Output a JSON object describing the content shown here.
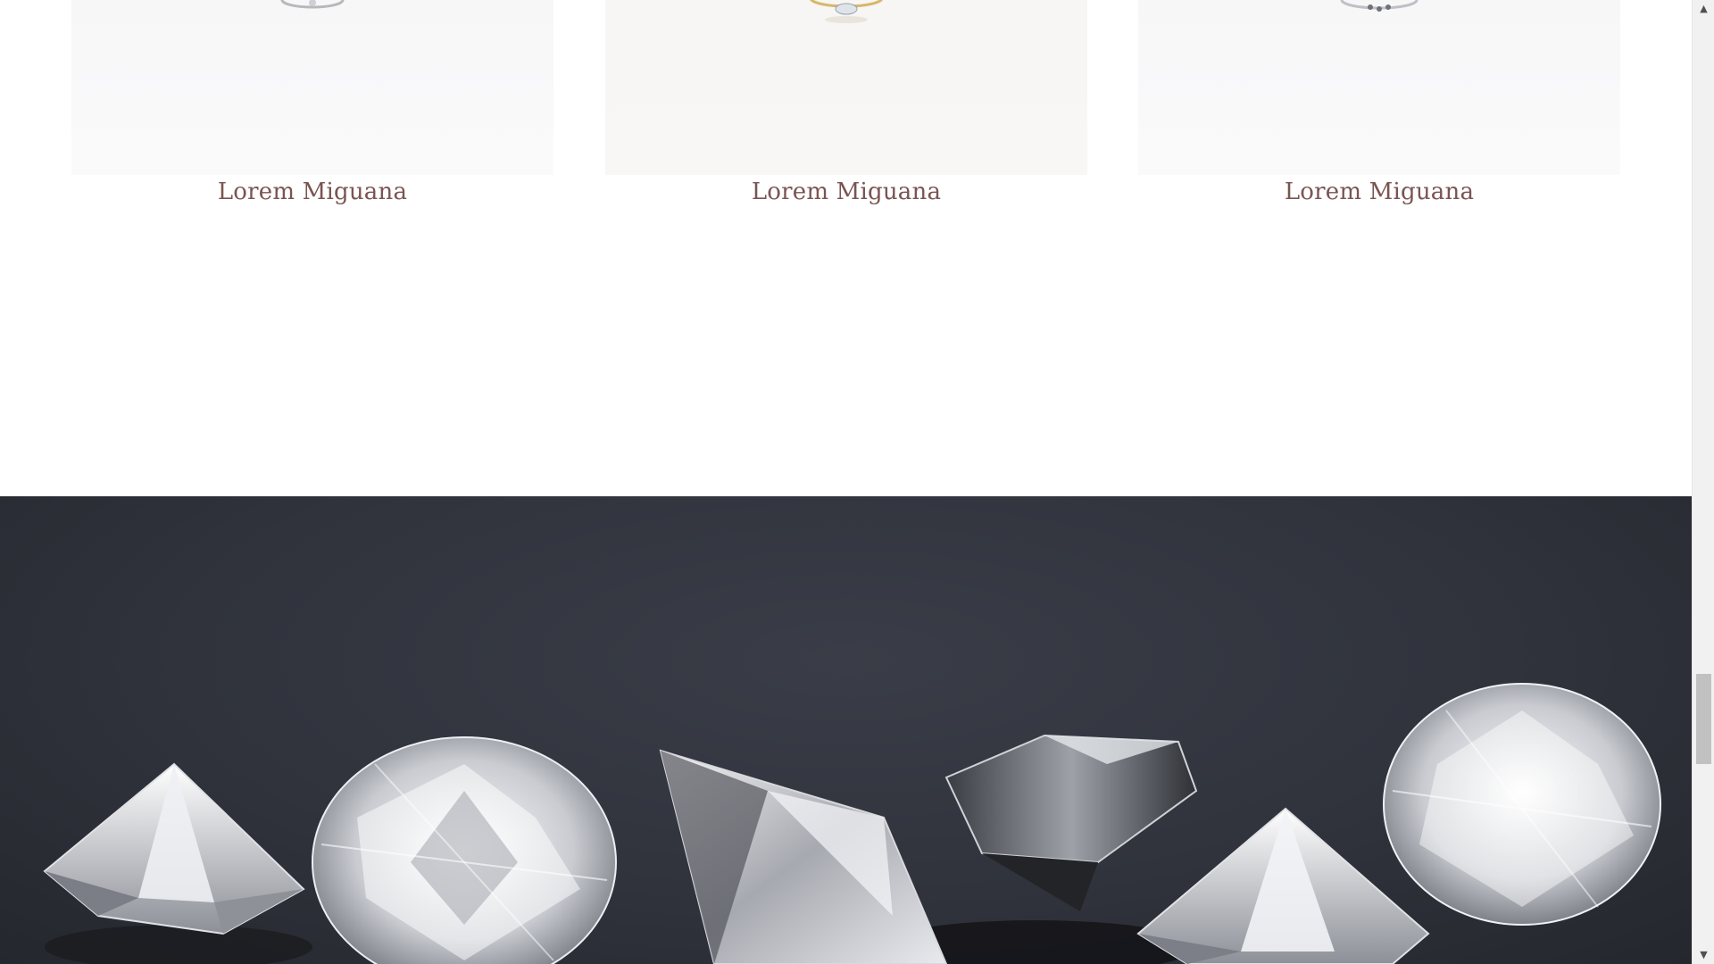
{
  "products": [
    {
      "title": "Lorem Miguana",
      "image_icon": "ring-icon"
    },
    {
      "title": "Lorem Miguana",
      "image_icon": "ring-icon"
    },
    {
      "title": "Lorem Miguana",
      "image_icon": "ring-icon"
    }
  ],
  "hero": {
    "image_icon": "diamonds-image",
    "background": "#30333c"
  },
  "colors": {
    "title_text": "#7a5451",
    "hero_bg": "#30333c"
  },
  "scrollbar": {
    "up_arrow": "▲",
    "down_arrow": "▼"
  }
}
